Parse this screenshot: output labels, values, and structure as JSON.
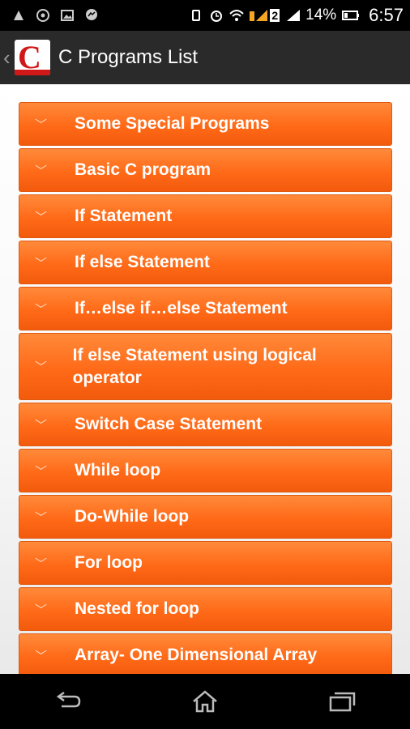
{
  "status_bar": {
    "left_icons": [
      "usb-debug-icon",
      "whatsapp-icon",
      "image-icon",
      "messenger-icon"
    ],
    "battery_percent": "14%",
    "time": "6:57",
    "sim_slot": "2"
  },
  "action_bar": {
    "title": "C Programs List",
    "logo_letter": "C"
  },
  "programs": [
    {
      "label": "Some Special Programs"
    },
    {
      "label": "Basic C program"
    },
    {
      "label": "If Statement"
    },
    {
      "label": "If else Statement"
    },
    {
      "label": "If…else if…else Statement"
    },
    {
      "label": "If else Statement using logical operator"
    },
    {
      "label": "Switch Case Statement"
    },
    {
      "label": "While loop"
    },
    {
      "label": "Do-While loop"
    },
    {
      "label": "For loop"
    },
    {
      "label": "Nested for loop"
    },
    {
      "label": "Array- One Dimensional Array"
    }
  ],
  "colors": {
    "accent": "#ff6a18",
    "logo_red": "#d01818",
    "action_bar": "#2a2a2a"
  }
}
